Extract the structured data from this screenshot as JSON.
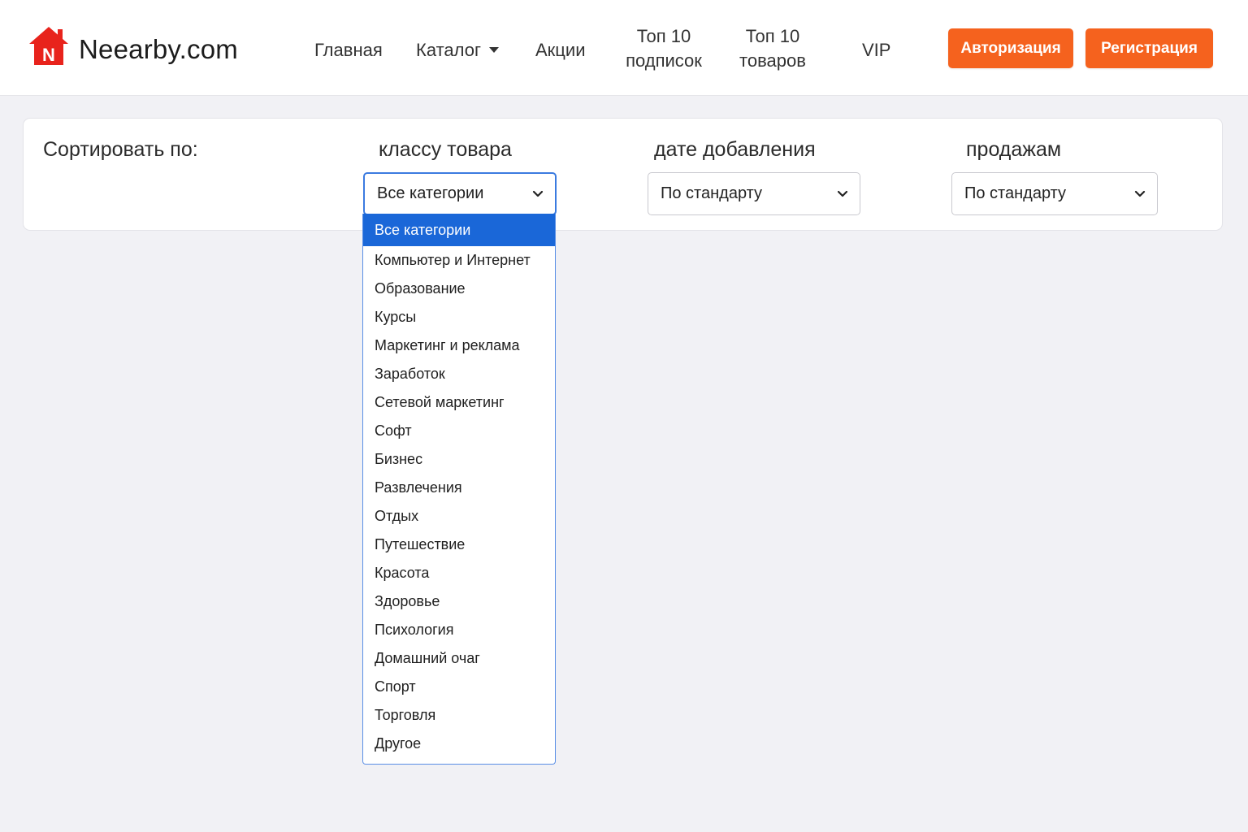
{
  "brand": {
    "name": "Neearby.com",
    "logo_letter": "N"
  },
  "nav": {
    "home": "Главная",
    "catalog": "Каталог",
    "promos": "Акции",
    "top_subs_line1": "Топ 10",
    "top_subs_line2": "подписок",
    "top_goods_line1": "Топ 10",
    "top_goods_line2": "товаров",
    "vip": "VIP"
  },
  "auth": {
    "login": "Авторизация",
    "register": "Регистрация"
  },
  "sort": {
    "label": "Сортировать по:",
    "class_label": "классу товара",
    "class_value": "Все категории",
    "date_label": "дате добавления",
    "date_value": "По стандарту",
    "sales_label": "продажам",
    "sales_value": "По стандарту"
  },
  "dropdown": {
    "options": [
      "Все категории",
      "Компьютер и Интернет",
      "Образование",
      "Курсы",
      "Маркетинг и реклама",
      "Заработок",
      "Сетевой маркетинг",
      "Софт",
      "Бизнес",
      "Развлечения",
      "Отдых",
      "Путешествие",
      "Красота",
      "Здоровье",
      "Психология",
      "Домашний очаг",
      "Спорт",
      "Торговля",
      "Другое"
    ]
  },
  "colors": {
    "accent": "#f5621e",
    "logo_red": "#e8231c",
    "selected_option": "#1a67d8",
    "focus_border": "#3b7be0"
  }
}
